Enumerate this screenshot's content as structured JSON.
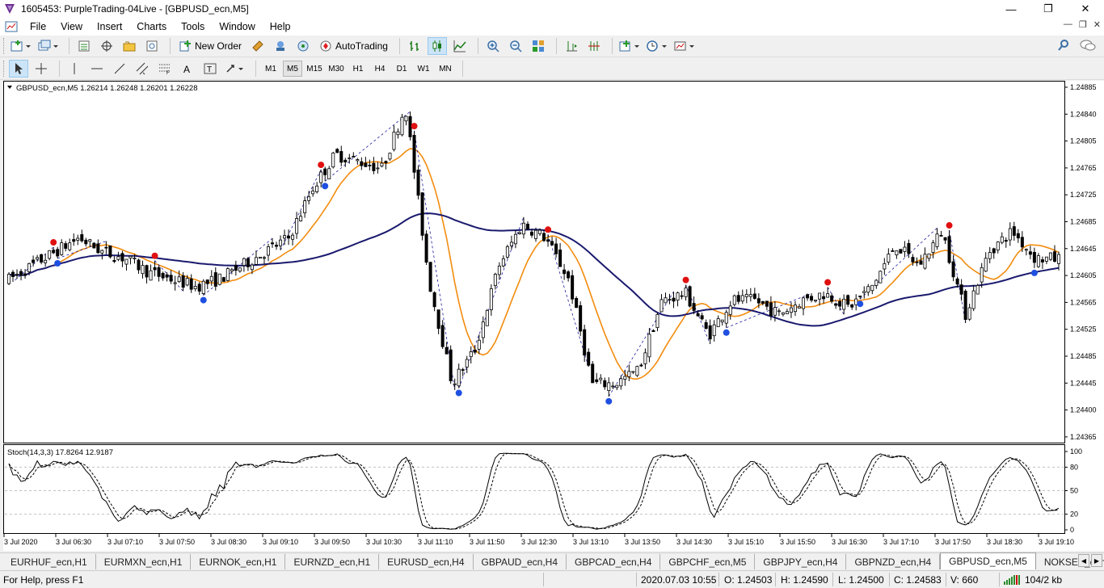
{
  "window": {
    "title": "1605453: PurpleTrading-04Live - [GBPUSD_ecn,M5]",
    "min": "—",
    "max": "❐",
    "close": "✕"
  },
  "menu": [
    "File",
    "View",
    "Insert",
    "Charts",
    "Tools",
    "Window",
    "Help"
  ],
  "toolbar": {
    "new_order": "New Order",
    "auto_trading": "AutoTrading"
  },
  "timeframes": [
    "M1",
    "M5",
    "M15",
    "M30",
    "H1",
    "H4",
    "D1",
    "W1",
    "MN"
  ],
  "active_timeframe": "M5",
  "chart": {
    "info": "GBPUSD_ecn,M5  1.26214 1.26248 1.26201 1.26228",
    "price_ticks": [
      "1.24885",
      "1.24840",
      "1.24805",
      "1.24765",
      "1.24725",
      "1.24685",
      "1.24645",
      "1.24605",
      "1.24565",
      "1.24525",
      "1.24485",
      "1.24445",
      "1.24400",
      "1.24365"
    ],
    "time_ticks": [
      "3 Jul 2020",
      "3 Jul 06:30",
      "3 Jul 07:10",
      "3 Jul 07:50",
      "3 Jul 08:30",
      "3 Jul 09:10",
      "3 Jul 09:50",
      "3 Jul 10:30",
      "3 Jul 11:10",
      "3 Jul 11:50",
      "3 Jul 12:30",
      "3 Jul 13:10",
      "3 Jul 13:50",
      "3 Jul 14:30",
      "3 Jul 15:10",
      "3 Jul 15:50",
      "3 Jul 16:30",
      "3 Jul 17:10",
      "3 Jul 17:50",
      "3 Jul 18:30",
      "3 Jul 19:10"
    ],
    "stoch_label": "Stoch(14,3,3) 17.8264 12.9187",
    "stoch_ticks": [
      "100",
      "80",
      "50",
      "20",
      "0"
    ],
    "colors": {
      "bull": "#ffffff",
      "bear": "#000000",
      "ma_fast": "#f28c0f",
      "ma_slow": "#1a1a6e",
      "buy_dot": "#1f4fe0",
      "sell_dot": "#e01010",
      "zigzag": "#1a1aa0"
    }
  },
  "chart_data": {
    "type": "candlestick",
    "symbol": "GBPUSD_ecn",
    "timeframe": "M5",
    "ohlc_last": {
      "open": 1.26214,
      "high": 1.26248,
      "low": 1.26201,
      "close": 1.26228
    },
    "ylim": [
      1.24365,
      1.24885
    ],
    "close_path": [
      1.246,
      1.2462,
      1.2464,
      1.2466,
      1.2464,
      1.2463,
      1.2461,
      1.246,
      1.2459,
      1.246,
      1.2462,
      1.2464,
      1.2466,
      1.2473,
      1.2478,
      1.2477,
      1.2476,
      1.2485,
      1.246,
      1.2445,
      1.245,
      1.2462,
      1.2468,
      1.2466,
      1.246,
      1.2445,
      1.2445,
      1.2447,
      1.2457,
      1.2458,
      1.2452,
      1.2457,
      1.2457,
      1.2455,
      1.2457,
      1.2458,
      1.2456,
      1.2459,
      1.2465,
      1.2462,
      1.2467,
      1.2455,
      1.2464,
      1.2467,
      1.2463,
      1.2463
    ]
  },
  "tabs": [
    "EURHUF_ecn,H1",
    "EURMXN_ecn,H1",
    "EURNOK_ecn,H1",
    "EURNZD_ecn,H1",
    "EURUSD_ecn,H4",
    "GBPAUD_ecn,H4",
    "GBPCAD_ecn,H4",
    "GBPCHF_ecn,M5",
    "GBPJPY_ecn,H4",
    "GBPNZD_ecn,H4",
    "GBPUSD_ecn,M5",
    "NOKSEK_ecn,Daily"
  ],
  "active_tab": "GBPUSD_ecn,M5",
  "status": {
    "help": "For Help, press F1",
    "datetime": "2020.07.03 10:55",
    "open": "O: 1.24503",
    "high": "H: 1.24590",
    "low": "L: 1.24500",
    "close": "C: 1.24583",
    "volume": "V: 660",
    "traffic": "104/2 kb"
  }
}
